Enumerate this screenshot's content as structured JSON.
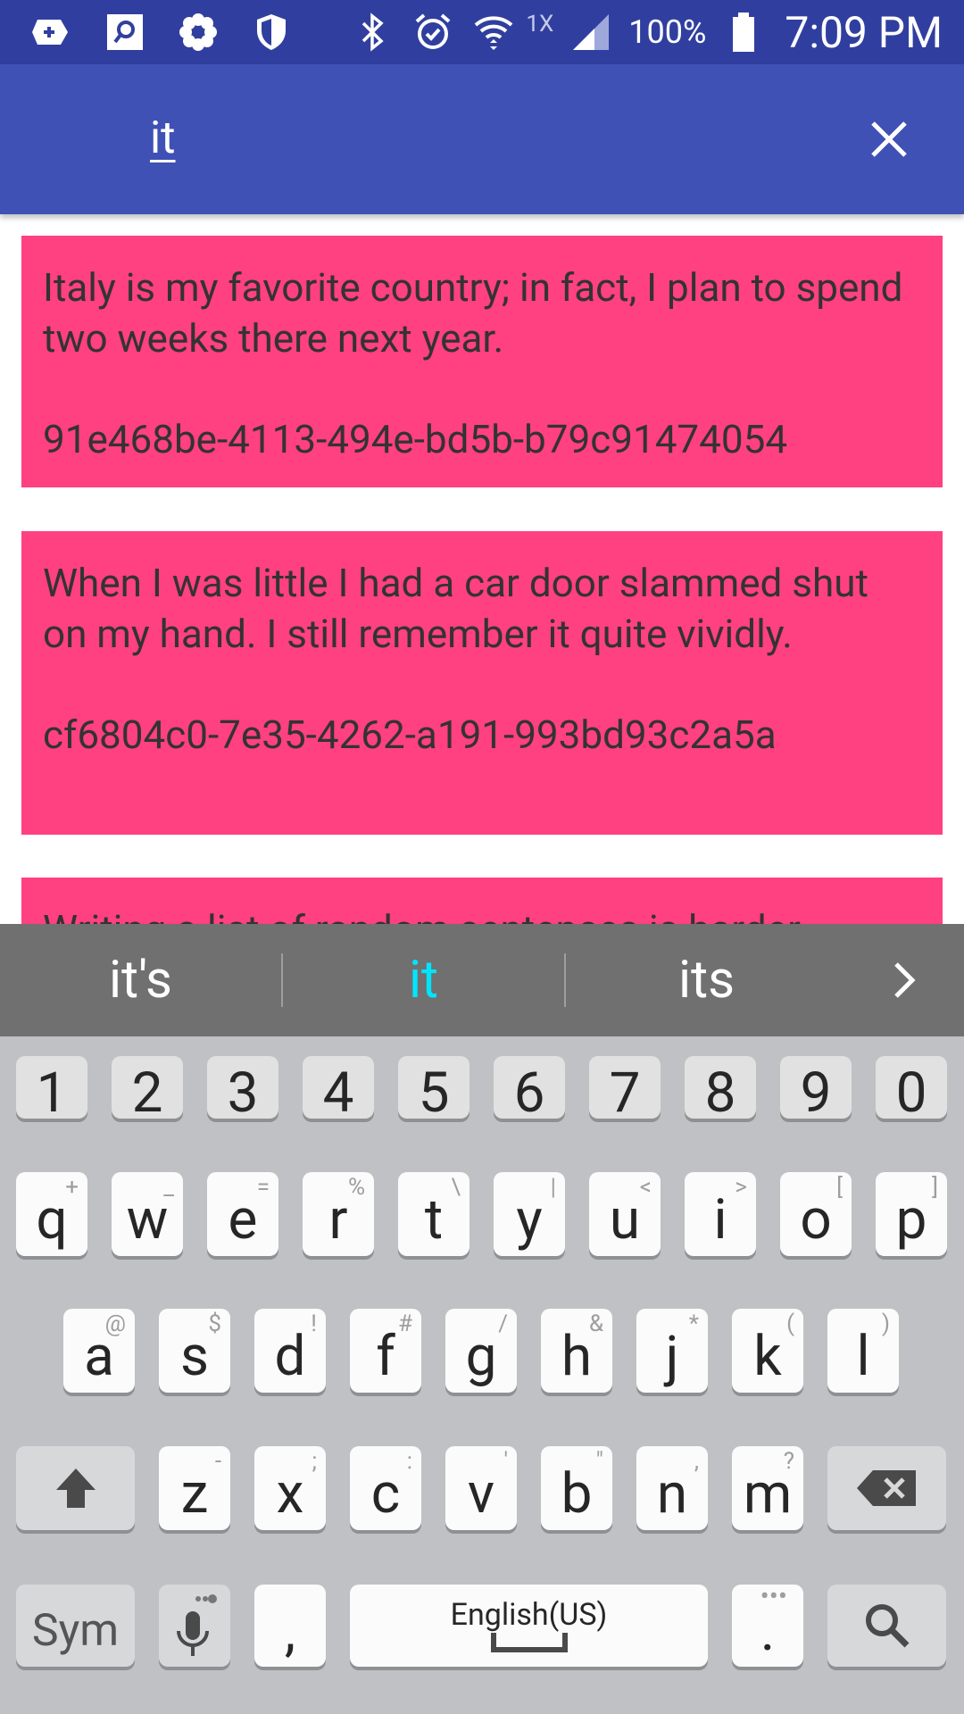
{
  "status_bar": {
    "network": "1X",
    "battery": "100%",
    "time": "7:09 PM"
  },
  "search": {
    "query": "it"
  },
  "results": [
    {
      "sentence": "Italy is my favorite country; in fact, I plan to spend two weeks there next year.",
      "uuid": "91e468be-4113-494e-bd5b-b79c91474054"
    },
    {
      "sentence": "When I was little I had a car door slammed shut on my hand. I still remember it quite vividly.",
      "uuid": "cf6804c0-7e35-4262-a191-993bd93c2a5a"
    },
    {
      "sentence": "Writing a list of random sentences is harder"
    }
  ],
  "keyboard": {
    "suggestions": [
      "it's",
      "it",
      "its"
    ],
    "selected_suggestion": "it",
    "number_row": [
      "1",
      "2",
      "3",
      "4",
      "5",
      "6",
      "7",
      "8",
      "9",
      "0"
    ],
    "row1": [
      {
        "key": "q",
        "hint": "+"
      },
      {
        "key": "w",
        "hint": "_"
      },
      {
        "key": "e",
        "hint": "="
      },
      {
        "key": "r",
        "hint": "%"
      },
      {
        "key": "t",
        "hint": "\\"
      },
      {
        "key": "y",
        "hint": "|"
      },
      {
        "key": "u",
        "hint": "<"
      },
      {
        "key": "i",
        "hint": ">"
      },
      {
        "key": "o",
        "hint": "["
      },
      {
        "key": "p",
        "hint": "]"
      }
    ],
    "row2": [
      {
        "key": "a",
        "hint": "@"
      },
      {
        "key": "s",
        "hint": "$"
      },
      {
        "key": "d",
        "hint": "!"
      },
      {
        "key": "f",
        "hint": "#"
      },
      {
        "key": "g",
        "hint": "/"
      },
      {
        "key": "h",
        "hint": "&"
      },
      {
        "key": "j",
        "hint": "*"
      },
      {
        "key": "k",
        "hint": "("
      },
      {
        "key": "l",
        "hint": ")"
      }
    ],
    "row3": [
      {
        "key": "z",
        "hint": "-"
      },
      {
        "key": "x",
        "hint": ";"
      },
      {
        "key": "c",
        "hint": ":"
      },
      {
        "key": "v",
        "hint": "'"
      },
      {
        "key": "b",
        "hint": "\""
      },
      {
        "key": "n",
        "hint": ","
      },
      {
        "key": "m",
        "hint": "?"
      }
    ],
    "sym_label": "Sym",
    "comma": ",",
    "space_label": "English(US)",
    "period": "."
  },
  "colors": {
    "status_bar": "#303f9f",
    "app_bar": "#3f51b5",
    "card": "#ff4081",
    "selected_suggestion": "#00e5ff"
  }
}
